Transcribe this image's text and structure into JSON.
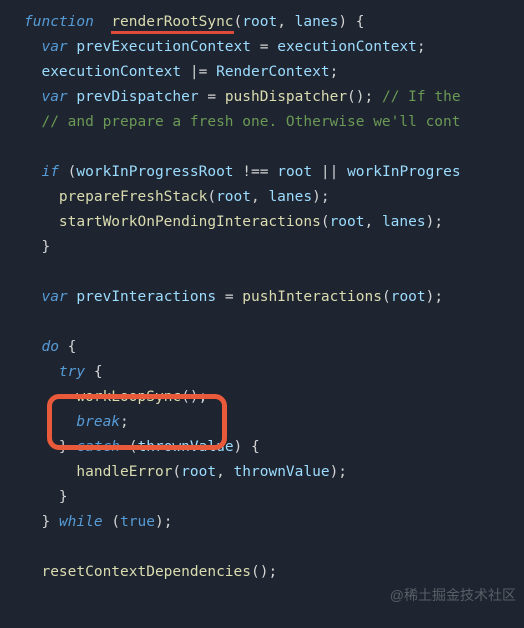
{
  "code": {
    "l1_kw": "function",
    "l1_fn": "renderRootSync",
    "l1_p1": "root",
    "l1_p2": "lanes",
    "l2_kw": "var",
    "l2_lhs": "prevExecutionContext",
    "l2_rhs": "executionContext",
    "l3_lhs": "executionContext",
    "l3_rhs": "RenderContext",
    "l4_kw": "var",
    "l4_lhs": "prevDispatcher",
    "l4_fn": "pushDispatcher",
    "l4_comment": "// If the",
    "l5_comment": "// and prepare a fresh one. Otherwise we'll cont",
    "l7_kw": "if",
    "l7_c1": "workInProgressRoot",
    "l7_c2": "root",
    "l7_c3": "workInProgres",
    "l8_fn": "prepareFreshStack",
    "l8_a1": "root",
    "l8_a2": "lanes",
    "l9_fn": "startWorkOnPendingInteractions",
    "l9_a1": "root",
    "l9_a2": "lanes",
    "l12_kw": "var",
    "l12_lhs": "prevInteractions",
    "l12_fn": "pushInteractions",
    "l12_a1": "root",
    "l14_kw": "do",
    "l15_kw": "try",
    "l16_fn": "workLoopSync",
    "l17_kw": "break",
    "l18_kw": "catch",
    "l18_p": "thrownValue",
    "l19_fn": "handleError",
    "l19_a1": "root",
    "l19_a2": "thrownValue",
    "l21_kw": "while",
    "l21_lit": "true",
    "l23_fn": "resetContextDependencies"
  },
  "watermark": "@稀土掘金技术社区"
}
